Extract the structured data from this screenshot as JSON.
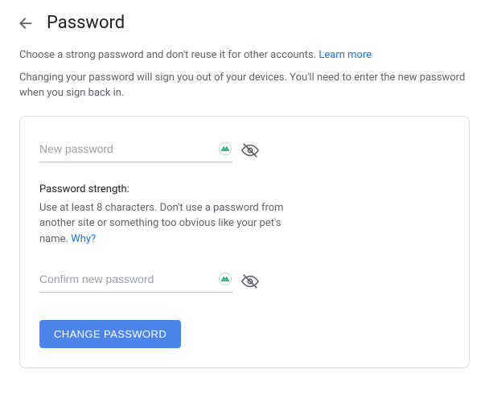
{
  "header": {
    "title": "Password"
  },
  "intro": {
    "line1_prefix": "Choose a strong password and don't reuse it for other accounts. ",
    "learn_more": "Learn more",
    "line2": "Changing your password will sign you out of your devices. You'll need to enter the new password when you sign back in."
  },
  "form": {
    "new_password": {
      "placeholder": "New password",
      "value": ""
    },
    "confirm_password": {
      "placeholder": "Confirm new password",
      "value": ""
    },
    "strength": {
      "label": "Password strength:",
      "desc_prefix": "Use at least 8 characters. Don't use a password from another site or something too obvious like your pet's name. ",
      "why_link": "Why?"
    },
    "submit_label": "CHANGE PASSWORD"
  },
  "colors": {
    "primary": "#4c84ea",
    "link": "#1a73e8",
    "border": "#dadce0",
    "text_secondary": "#5f6368",
    "placeholder": "#9aa0a6"
  }
}
